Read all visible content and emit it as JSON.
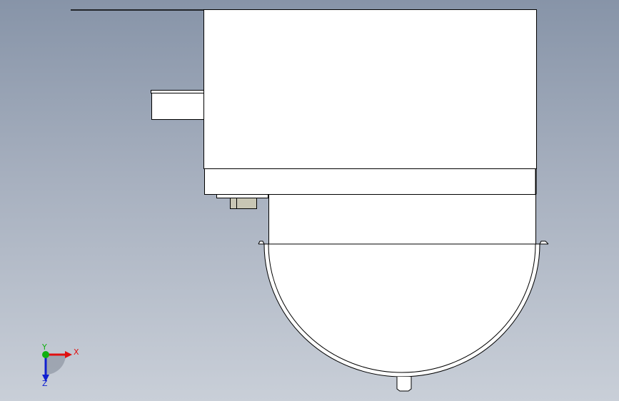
{
  "triad": {
    "x_label": "X",
    "y_label": "Y",
    "z_label": "Z",
    "x_color": "#e01010",
    "y_color": "#10b010",
    "z_color": "#1020d0"
  },
  "colors": {
    "part_fill": "#ffffff",
    "edge": "#000000",
    "connector_fill": "#c8c6b4"
  }
}
